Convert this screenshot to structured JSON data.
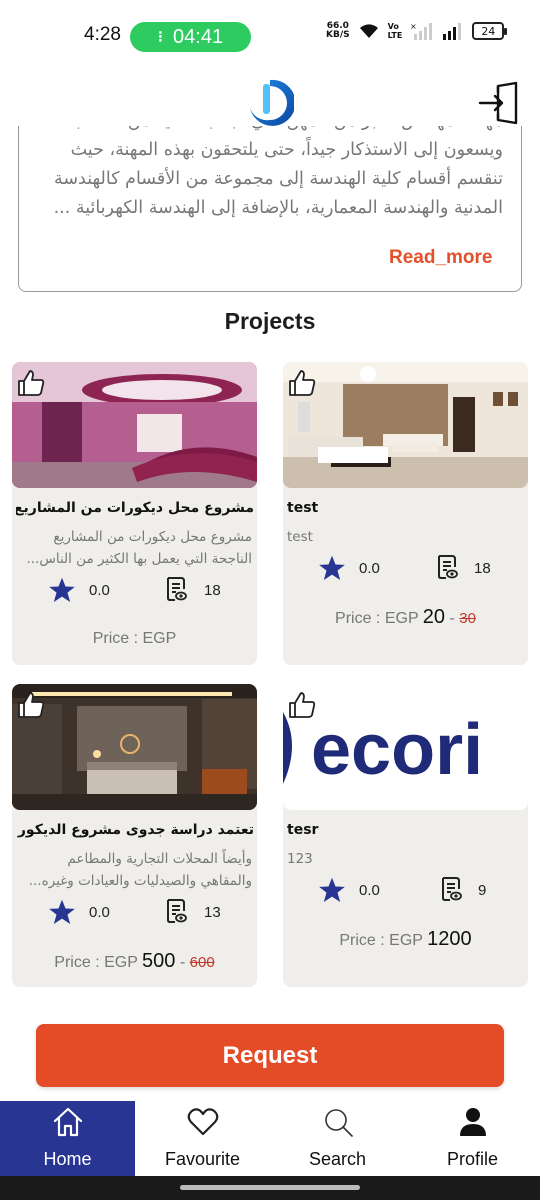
{
  "status_bar": {
    "time": "4:28",
    "call_timer": "04:41",
    "net_speed_value": "66.0",
    "net_speed_unit": "KB/S",
    "network_label_top": "Vo",
    "network_label_bottom": "LTE",
    "battery": "24"
  },
  "about": {
    "lines": [
      "مهنة المهندس تعتبر من المهن التي تجذب العديد من الطلاب،",
      "ويسعون إلى الاستذكار جيداً، حتى يلتحقون بهذه المهنة، حيث",
      "تنقسم أقسام كلية الهندسة إلى مجموعة من الأقسام كالهندسة",
      "المدنية والهندسة المعمارية، بالإضافة إلى الهندسة الكهربائية ..."
    ],
    "read_more": "Read_more"
  },
  "section_title": "Projects",
  "projects": [
    {
      "title": "مشروع محل ديكورات من المشاريع الن...",
      "desc": "مشروع محل ديكورات من المشاريع الناجحة التي يعمل بها الكثير من الناس...",
      "rating": "0.0",
      "views": "18",
      "price_label": "Price :",
      "currency": "EGP",
      "price": "",
      "old_price": "",
      "dash": ""
    },
    {
      "title": "test",
      "desc": "test",
      "rating": "0.0",
      "views": "18",
      "price_label": "Price :",
      "currency": "EGP",
      "price": "20",
      "old_price": "30",
      "dash": "-"
    },
    {
      "title": "تعتمد دراسة جدوى مشروع الديكور عل...",
      "desc": "وأيضاً المحلات التجارية والمطاعم والمقاهي والصيدليات والعيادات وغيره...",
      "rating": "0.0",
      "views": "13",
      "price_label": "Price :",
      "currency": "EGP",
      "price": "500",
      "old_price": "600",
      "dash": "-"
    },
    {
      "title": "tesr",
      "desc": "123",
      "rating": "0.0",
      "views": "9",
      "price_label": "Price :",
      "currency": "EGP",
      "price": "1200",
      "old_price": "",
      "dash": ""
    }
  ],
  "decor_image_text": "ecori",
  "request_button": "Request",
  "nav": {
    "home": "Home",
    "favourite": "Favourite",
    "search": "Search",
    "profile": "Profile"
  },
  "colors": {
    "accent": "#e34c27",
    "nav_active": "#283593",
    "star": "#283593",
    "card_bg": "#efeeeb",
    "call_pill": "#2ecc60"
  }
}
